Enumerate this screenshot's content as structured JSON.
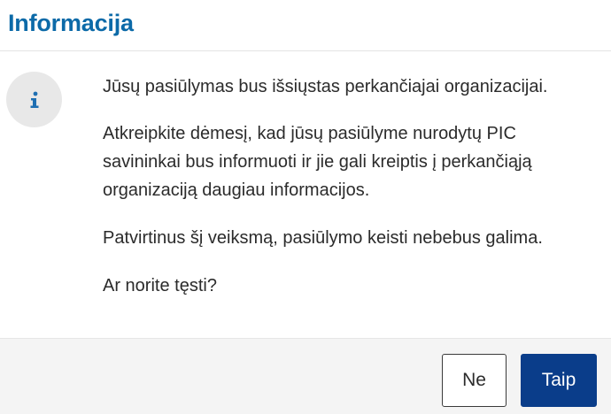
{
  "dialog": {
    "title": "Informacija",
    "icon": "info-icon",
    "message_lines": [
      "Jūsų pasiūlymas bus išsiųstas perkančiajai organizacijai.",
      "Atkreipkite dėmesį, kad jūsų pasiūlyme nurodytų PIC",
      "savininkai bus informuoti ir jie gali kreiptis į perkančiąją",
      "organizaciją daugiau informacijos.",
      "Patvirtinus šį veiksmą, pasiūlymo keisti nebebus galima.",
      "Ar norite tęsti?"
    ],
    "buttons": {
      "no_label": "Ne",
      "yes_label": "Taip"
    }
  },
  "colors": {
    "title": "#0c6aa8",
    "primary_button": "#0a3d8a",
    "icon": "#1f6fb2",
    "icon_background": "#e8e8e8",
    "footer_background": "#f4f4f4"
  }
}
